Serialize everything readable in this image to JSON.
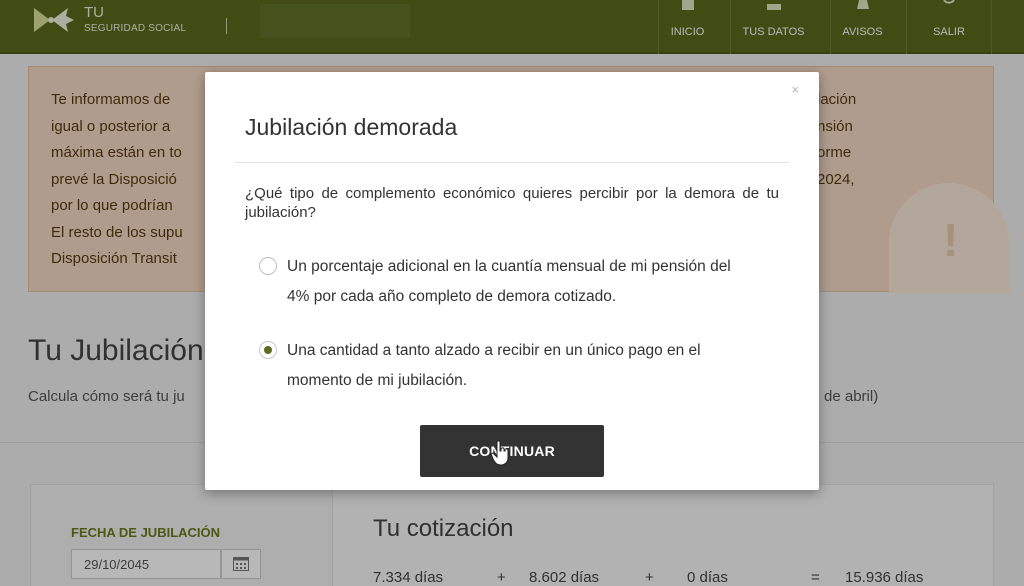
{
  "header": {
    "logo_line1": "TU",
    "logo_line2": "SEGURIDAD SOCIAL",
    "nav": [
      {
        "label": "INICIO",
        "icon": "home-icon"
      },
      {
        "label": "TUS DATOS",
        "icon": "user-data-icon"
      },
      {
        "label": "AVISOS",
        "icon": "bell-icon"
      },
      {
        "label": "SALIR",
        "icon": "power-icon"
      }
    ]
  },
  "notice": {
    "lines_left": [
      "Te informamos de",
      "igual o posterior a",
      "máxima están en to",
      "prevé la Disposició",
      "por lo que podrían",
      "El resto de los supu",
      "Disposición Transit"
    ],
    "lines_right": [
      "lación",
      "nsión",
      "orme",
      "2024,"
    ]
  },
  "page": {
    "title": "Tu Jubilación",
    "subtitle": "Calcula cómo será tu ju",
    "subtitle_right": "de abril)"
  },
  "calculator": {
    "fecha_label": "FECHA DE JUBILACIÓN",
    "fecha_value": "29/10/2045",
    "cotizacion_title": "Tu cotización",
    "row": {
      "a": "7.334 días",
      "op1": "+",
      "b": "8.602 días",
      "op2": "+",
      "c": "0 días",
      "eq": "=",
      "total": "15.936 días"
    }
  },
  "modal": {
    "close": "×",
    "title": "Jubilación demorada",
    "question": "¿Qué tipo de complemento económico quieres percibir por la demora de tu jubilación?",
    "options": [
      {
        "line1": "Un porcentaje adicional en la cuantía mensual de mi pensión del",
        "line2": "4% por cada año completo de demora cotizado.",
        "selected": false
      },
      {
        "line1": "Una cantidad a tanto alzado a recibir en un único pago en el",
        "line2": "momento de mi jubilación.",
        "selected": true
      }
    ],
    "continue_label": "CONTINUAR"
  },
  "colors": {
    "brand_green": "#5a6a1e",
    "notice_bg": "#f3d9c4",
    "button_dark": "#333333"
  }
}
